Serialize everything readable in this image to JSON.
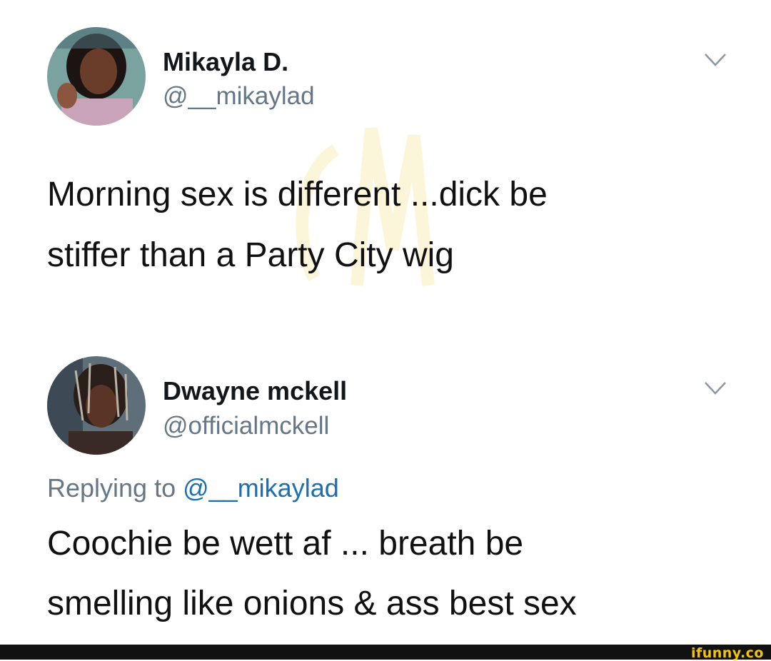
{
  "tweet1": {
    "name": "Mikayla D.",
    "handle": "@__mikaylad",
    "text_line1": "Morning sex is different ...dick be",
    "text_line2": "stiffer than a Party City wig"
  },
  "tweet2": {
    "name": "Dwayne mckell",
    "handle": "@officialmckell",
    "reply_prefix": "Replying to ",
    "reply_mention": "@__mikaylad",
    "text_line1": "Coochie be wett af ... breath be",
    "text_line2": "smelling like onions & ass  best sex"
  },
  "footer": {
    "brand": "ifunny.co"
  },
  "icons": {
    "more_options": "chevron-down-icon"
  },
  "colors": {
    "handle": "#657786",
    "mention": "#1b6fb3",
    "brand": "#f5c400",
    "footer_bg": "#111111"
  }
}
